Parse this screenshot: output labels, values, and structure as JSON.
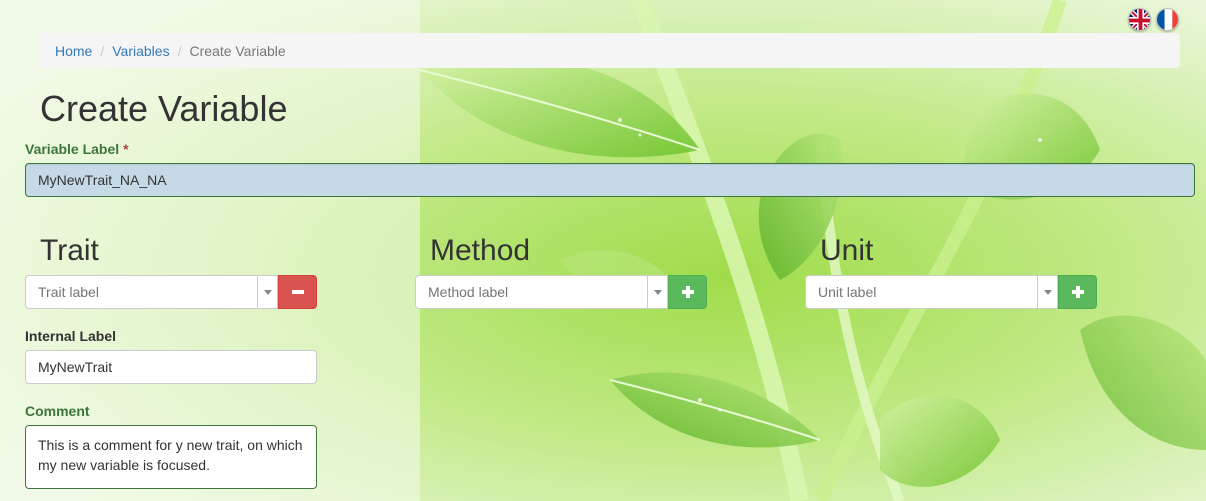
{
  "languages": [
    {
      "code": "en",
      "icon": "uk-flag-icon"
    },
    {
      "code": "fr",
      "icon": "france-flag-icon"
    }
  ],
  "breadcrumb": {
    "home": "Home",
    "variables": "Variables",
    "current": "Create Variable",
    "separator": "/"
  },
  "page": {
    "title": "Create Variable"
  },
  "variable_label": {
    "label": "Variable Label",
    "required_mark": "*",
    "value": "MyNewTrait_NA_NA"
  },
  "trait": {
    "heading": "Trait",
    "placeholder": "Trait label",
    "button_icon": "minus-icon"
  },
  "method": {
    "heading": "Method",
    "placeholder": "Method label",
    "button_icon": "plus-icon"
  },
  "unit": {
    "heading": "Unit",
    "placeholder": "Unit label",
    "button_icon": "plus-icon"
  },
  "internal_label": {
    "label": "Internal Label",
    "value": "MyNewTrait"
  },
  "comment": {
    "label": "Comment",
    "value": "This is a comment for y new trait, on which my new variable is focused."
  },
  "colors": {
    "success_label": "#3c763d",
    "danger": "#d9534f",
    "success_btn": "#5cb85c",
    "link": "#337ab7",
    "focused_input_bg": "#c5d9e6"
  }
}
